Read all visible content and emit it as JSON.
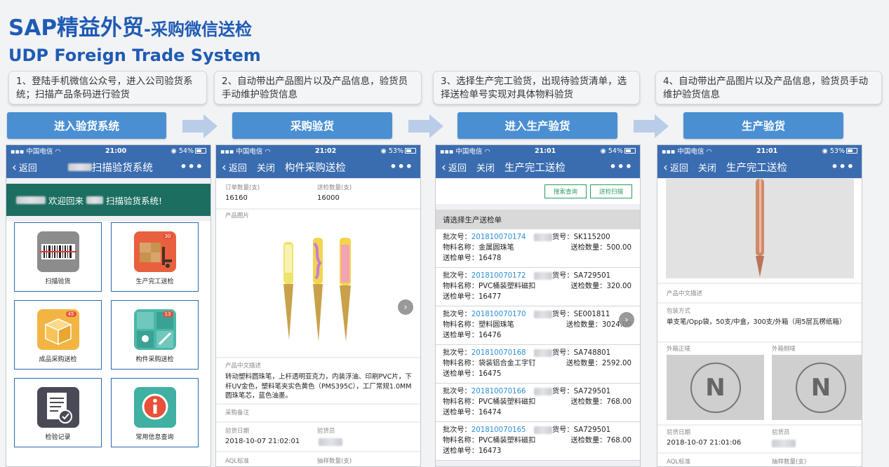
{
  "header": {
    "title_main": "SAP精益外贸",
    "title_sub": "-采购微信送检",
    "title_en": "UDP Foreign Trade System"
  },
  "steps": [
    {
      "desc": "1、登陆手机微信公众号，进入公司验货系统；扫描产品条码进行验货",
      "button": "进入验货系统"
    },
    {
      "desc": "2、自动带出产品图片以及产品信息，验货员手动维护验货信息",
      "button": "采购验货"
    },
    {
      "desc": "3、选择生产完工验货，出现待验货清单，选择送检单号实现对具体物料验货",
      "button": "进入生产验货"
    },
    {
      "desc": "4、自动带出产品图片以及产品信息，验货员手动维护验货信息",
      "button": "生产验货"
    }
  ],
  "phones": [
    {
      "status": {
        "carrier": "中国电信",
        "time": "21:00",
        "battery": "54%"
      },
      "nav": {
        "back": "返回",
        "title": "扫描验货系统"
      },
      "welcome": "欢迎回来",
      "welcome_suffix": "扫描验货系统!",
      "tiles": [
        {
          "label": "扫描验货",
          "icon": "barcode-icon"
        },
        {
          "label": "生产完工送检",
          "icon": "forklift-icon",
          "badge": "30"
        },
        {
          "label": "成品采购送检",
          "icon": "box-icon",
          "badge": "45"
        },
        {
          "label": "构件采购送检",
          "icon": "tools-icon",
          "badge": "13"
        },
        {
          "label": "检验记录",
          "icon": "document-check-icon"
        },
        {
          "label": "常用信息查询",
          "icon": "info-icon"
        }
      ]
    },
    {
      "status": {
        "carrier": "中国电信",
        "time": "21:02",
        "battery": "53%"
      },
      "nav": {
        "back": "返回",
        "close": "关闭",
        "title": "构件采购送检"
      },
      "order_qty_label": "订单数量(支)",
      "order_qty": "16160",
      "inspect_qty_label": "送检数量(支)",
      "inspect_qty": "16000",
      "image_label": "产品图片",
      "desc_label": "产品中文描述",
      "desc": "转动塑料圆珠笔，上杆透明亚克力，内装浮油、印刷PVC片，下杆UV金色，塑料笔夹实色黄色（PMS395C），工厂常规1.0MM圆珠笔芯，蓝色油墨。",
      "remark_label": "采购备注",
      "date_label": "验货日期",
      "date": "2018-10-07 21:02:01",
      "inspector_label": "验货员",
      "aql_label": "AQL标准",
      "sample_label": "抽样数量(支)"
    },
    {
      "status": {
        "carrier": "中国电信",
        "time": "21:01",
        "battery": "54%"
      },
      "nav": {
        "back": "返回",
        "close": "关闭",
        "title": "生产完工送检"
      },
      "btn_search": "搜索查询",
      "btn_scan": "送检扫描",
      "list_title": "请选择生产送检单",
      "batch_label": "批次号：",
      "material_label": "物料名称：",
      "doc_label": "送检单号：",
      "item_label": "货号：",
      "qty_label": "送检数量：",
      "rows": [
        {
          "batch": "201810070174",
          "item": "SK115200",
          "material": "金属圆珠笔",
          "qty": "500.00",
          "doc": "16478"
        },
        {
          "batch": "201810070172",
          "item": "SA729501",
          "material": "PVC桶装塑料磁扣",
          "qty": "320.00",
          "doc": "16477"
        },
        {
          "batch": "201810070170",
          "item": "SE001811",
          "material": "塑料圆珠笔",
          "qty": "3024.00",
          "doc": "16476"
        },
        {
          "batch": "201810070168",
          "item": "SA748801",
          "material": "袋装铝合金工字钉",
          "qty": "2592.00",
          "doc": "16475"
        },
        {
          "batch": "201810070166",
          "item": "SA729501",
          "material": "PVC桶装塑料磁扣",
          "qty": "768.00",
          "doc": "16474"
        },
        {
          "batch": "201810070165",
          "item": "SA729501",
          "material": "PVC桶装塑料磁扣",
          "qty": "768.00",
          "doc": "16473"
        }
      ]
    },
    {
      "status": {
        "carrier": "中国电信",
        "time": "21:01",
        "battery": "53%"
      },
      "nav": {
        "back": "返回",
        "close": "关闭",
        "title": "生产完工送检"
      },
      "desc_label": "产品中文描述",
      "pack_label": "包装方式",
      "pack": "单支笔/Opp袋，50支/中盒，300支/外箱（用5层瓦楞纸箱）",
      "front_label": "外箱正唛",
      "side_label": "外箱侧唛",
      "mark_letter": "N",
      "date_label": "验货日期",
      "date": "2018-10-07 21:01:06",
      "inspector_label": "验货员",
      "aql_label": "AQL标准",
      "sample_label": "抽样数量(支)"
    }
  ]
}
